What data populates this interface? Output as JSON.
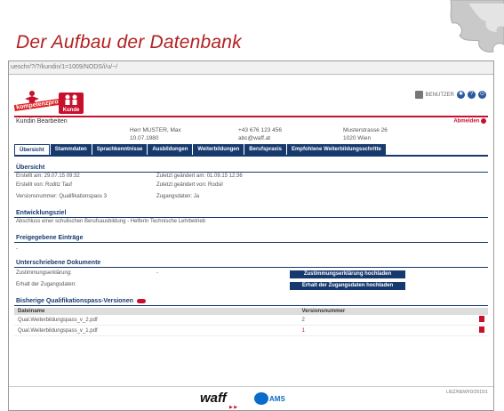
{
  "slide_title": "Der Aufbau der Datenbank",
  "browser": {
    "url": "ueschr/?/?/kundin/1=1009/NODS/i/u/~/"
  },
  "header": {
    "logo_text": "kompetenzprofil",
    "kunde_label": "Kunde",
    "user_name": "BENUTZER"
  },
  "kundin": {
    "title": "Kundin Bearbeiten",
    "abmelden": "Abmelden",
    "name": "Herr MUSTER, Max",
    "birthdate": "10.07.1980",
    "phone": "+43 676 123 456",
    "email": "abc@waff.at",
    "street": "Musterstrasse 26",
    "city": "1020 Wien"
  },
  "tabs": [
    "Übersicht",
    "Stammdaten",
    "Sprachkenntnisse",
    "Ausbildungen",
    "Weiterbildungen",
    "Berufspraxis",
    "Empfohlene Weiterbildungsschritte"
  ],
  "overview": {
    "heading": "Übersicht",
    "created": "Erstellt am: 29.07.15 09:32",
    "created_by": "Erstellt von: Roditz Tauf",
    "last_change": "Zuletzt geändert am: 01.09.15 12:36",
    "last_change_by": "Zuletzt geändert von: Rodsil",
    "version": "Versionsnummer: Qualifikationspass 3",
    "closed": "Zugangsdaten: Ja"
  },
  "goal": {
    "heading": "Entwicklungsziel",
    "text": "Abschluss einer schulischen Berufsausbildung - Helferin Technische Lehrbetrieb"
  },
  "shared": {
    "heading": "Freigegebene Einträge",
    "value": "-"
  },
  "signed": {
    "heading": "Unterschriebene Dokumente",
    "row1_label": "Zustimmungserklärung:",
    "row1_value": "-",
    "row2_label": "Erhalt der Zugangsdaten:",
    "btn1": "Zustimmungserklärung hochladen",
    "btn2": "Erhalt der Zugangsdaten hochladen"
  },
  "versions": {
    "heading": "Bisherige Qualifikationspass-Versionen",
    "col_file": "Dateiname",
    "col_version": "Versionsnummer",
    "rows": [
      {
        "file": "Qual.Weiterbildungspass_v_2.pdf",
        "version": "2"
      },
      {
        "file": "Qual.Weiterbildungspass_v_1.pdf",
        "version": "1"
      }
    ]
  },
  "footer": {
    "waff": "waff",
    "ams": "AMS",
    "right_text": "LIEZ/NEWFD/2015/1"
  }
}
